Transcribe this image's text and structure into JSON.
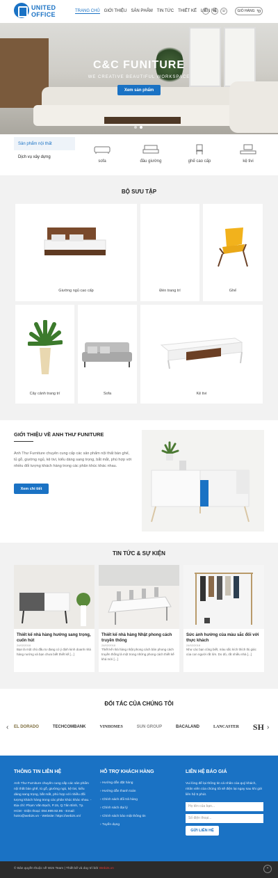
{
  "brand": {
    "line1": "UNITED",
    "line2": "OFFICE"
  },
  "nav": [
    "Trang chủ",
    "Giới thiệu",
    "Sản phẩm",
    "Tin tức",
    "Thiết kế",
    "Liên hệ"
  ],
  "social": [
    "f",
    "✉",
    "☏"
  ],
  "cart_label": "GIỎ HÀNG",
  "hero": {
    "title": "C&C FUNITURE",
    "subtitle": "WE CREATIVE BEAUTIFUL WORKSPACE",
    "button": "Xem sản phẩm"
  },
  "categories": {
    "side": [
      "Sản phẩm nội thất",
      "Dịch vụ xây dựng"
    ],
    "items": [
      {
        "label": "sofa",
        "icon": "sofa-icon"
      },
      {
        "label": "đầu giường",
        "icon": "headboard-icon"
      },
      {
        "label": "ghế cao cấp",
        "icon": "chair-icon"
      },
      {
        "label": "kệ tivi",
        "icon": "tv-stand-icon"
      }
    ]
  },
  "collection": {
    "title": "BỘ SƯU TẬP",
    "items": [
      "Giường ngủ cao cấp",
      "Đèn trang trí",
      "Ghế",
      "Cây cảnh trang trí",
      "Sofa",
      "Kệ tivi"
    ]
  },
  "about": {
    "title": "GIỚI THIỆU VỀ ANH THƯ FUNITURE",
    "text": "Anh Thư Furniture chuyên cung cấp các sản phẩm nội thất bàn ghế, tủ gỗ, giường ngủ, kệ tivi, kiểu dáng sang trọng, bắt mắt, phù hợp với nhiều đối tượng khách hàng trong các phân khúc khác nhau.",
    "button": "Xem chi tiết"
  },
  "news": {
    "title": "TIN TỨC & SỰ KIỆN",
    "items": [
      {
        "title": "Thiết kế nhà hàng hướng sang trọng, cuốn hút",
        "date": "24/02/2018",
        "excerpt": "Bạn là một chủ đầu tư đang có ý định kinh doanh nhà hàng nướng và bạn chưa biết thiết kế [...]"
      },
      {
        "title": "Thiết kế nhà hàng Nhật phong cách truyền thống",
        "date": "24/02/2018",
        "excerpt": "Thiết kế nhà hàng nhật phong cách bản phong cách truyền thống là một trong những phong cách thiết kế khá mới [...]"
      },
      {
        "title": "Sức ảnh hưởng của màu sắc đối với thực khách",
        "date": "24/02/2018",
        "excerpt": "Như các bạn cũng biết, màu sắc kích thích thị giác của con người rất lớn. Do đó, rất nhiều nhà [...]"
      }
    ]
  },
  "partners": {
    "title": "ĐỐI TÁC CỦA CHÚNG TÔI",
    "logos": [
      "EL DORADO",
      "TECHCOMBANK",
      "VINHOMES",
      "SUN GROUP",
      "BACALAND",
      "LANCASTER",
      "SH"
    ]
  },
  "footer": {
    "contact_title": "THÔNG TIN LIÊN HỆ",
    "contact_text": "Anh Thư Furniture chuyên cung cấp các sản phẩm nội thất bàn ghế, tủ gỗ, giường ngủ, kệ tivi, kiểu dáng sang trọng, bắt mắt, phù hợp với nhiều đối tượng khách hàng trong các phân khúc khác nhau. - Địa chỉ: Phạm Văn Bạch, P.15, Q.Tân Bình, Tp. HCM - Điện thoại: 094.999.92.95 - Email: hotro@web2s.vn - Website: https://web2s.vn/",
    "support_title": "HỖ TRỢ KHÁCH HÀNG",
    "support_links": [
      "Hướng dẫn đặt hàng",
      "Hướng dẫn thanh toán",
      "Chính sách đổi trả hàng",
      "Chính sách đại lý",
      "Chính sách bảo mật thông tin",
      "Tuyển dụng"
    ],
    "quote_title": "LIÊN HỆ BÁO GIÁ",
    "quote_text": "Vui lòng để lại thông tin cá nhân của quý khách, nhân viên của chúng tôi sẽ điện lại ngay sau khi gửi liên hệ 5 phút.",
    "name_placeholder": "Họ tên của bạn...",
    "phone_placeholder": "Số điện thoại...",
    "submit": "GỬI LIÊN HỆ"
  },
  "copyright": {
    "text": "© Bản quyền thuộc về W2s Team | Thiết kế và duy trì bởi ",
    "brand": "Web2s.vn"
  }
}
